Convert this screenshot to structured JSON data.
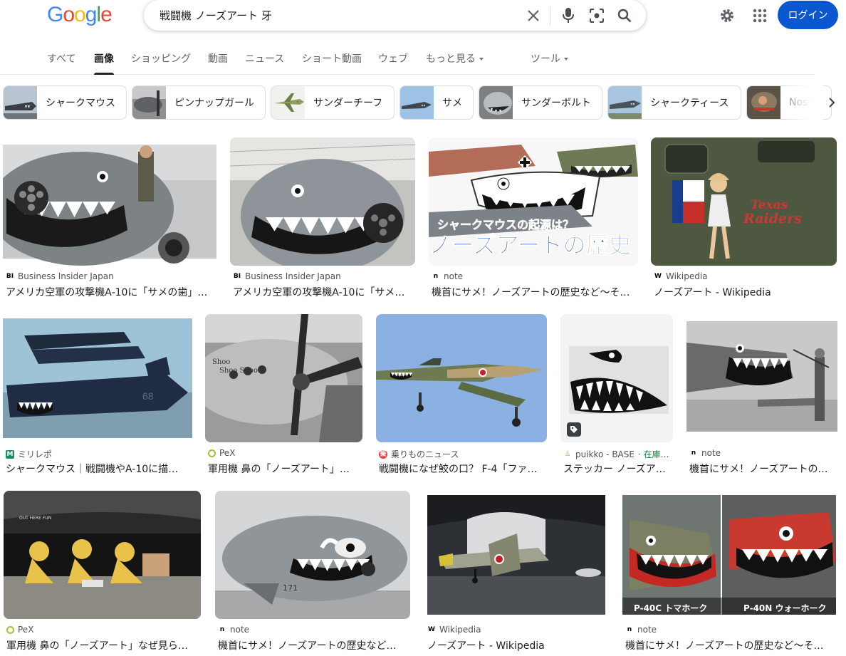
{
  "logo": {
    "text": "Google",
    "colors": [
      "#4285f4",
      "#ea4335",
      "#fbbc05",
      "#4285f4",
      "#34a853",
      "#ea4335"
    ]
  },
  "search": {
    "query": "戦闘機 ノーズアート 牙"
  },
  "header": {
    "login_label": "ログイン",
    "accent": "#0b57d0"
  },
  "tabs": [
    {
      "label": "すべて"
    },
    {
      "label": "画像"
    },
    {
      "label": "ショッピング"
    },
    {
      "label": "動画"
    },
    {
      "label": "ニュース"
    },
    {
      "label": "ショート動画"
    },
    {
      "label": "ウェブ"
    },
    {
      "label": "もっと見る"
    },
    {
      "label": "ツール"
    }
  ],
  "chips": [
    {
      "label": "シャークマウス"
    },
    {
      "label": "ピンナップガール"
    },
    {
      "label": "サンダーチーフ"
    },
    {
      "label": "サメ"
    },
    {
      "label": "サンダーボルト"
    },
    {
      "label": "シャークティース"
    },
    {
      "label": "Nose a"
    }
  ],
  "results": [
    {
      "source": "Business Insider Japan",
      "title": "アメリカ空軍の攻撃機A-10に「サメの歯」…"
    },
    {
      "source": "Business Insider Japan",
      "title": "アメリカ空軍の攻撃機A-10に「サメ…"
    },
    {
      "source": "note",
      "title": "機首にサメ！ノーズアートの歴史など〜そ…",
      "overlay_1": "シャークマウスの起源は？",
      "overlay_2": "ノーズアートの歴史"
    },
    {
      "source": "Wikipedia",
      "title": "ノーズアート - Wikipedia",
      "overlay_1": "Texas",
      "overlay_2": "Raiders"
    },
    {
      "source": "ミリレポ",
      "title": "シャークマウス｜戦闘機やA-10に描…"
    },
    {
      "source": "PeX",
      "title": "軍用機 鼻の「ノーズアート」…"
    },
    {
      "source": "乗りものニュース",
      "title": "戦闘機になぜ鮫の口？ F-4「ファ…"
    },
    {
      "source": "puikko - BASE",
      "source_extra": " · 在庫…",
      "title": "ステッカー ノーズア…"
    },
    {
      "source": "note",
      "title": "機首にサメ！ノーズアートの…"
    },
    {
      "source": "PeX",
      "title": "軍用機 鼻の「ノーズアート」なぜ見ら…"
    },
    {
      "source": "note",
      "title": "機首にサメ！ノーズアートの歴史など…"
    },
    {
      "source": "Wikipedia",
      "title": "ノーズアート - Wikipedia"
    },
    {
      "source": "note",
      "title": "機首にサメ！ノーズアートの歴史など〜そ…",
      "caption_left": "P-40C トマホーク",
      "caption_right": "P-40N ウォーホーク"
    }
  ]
}
